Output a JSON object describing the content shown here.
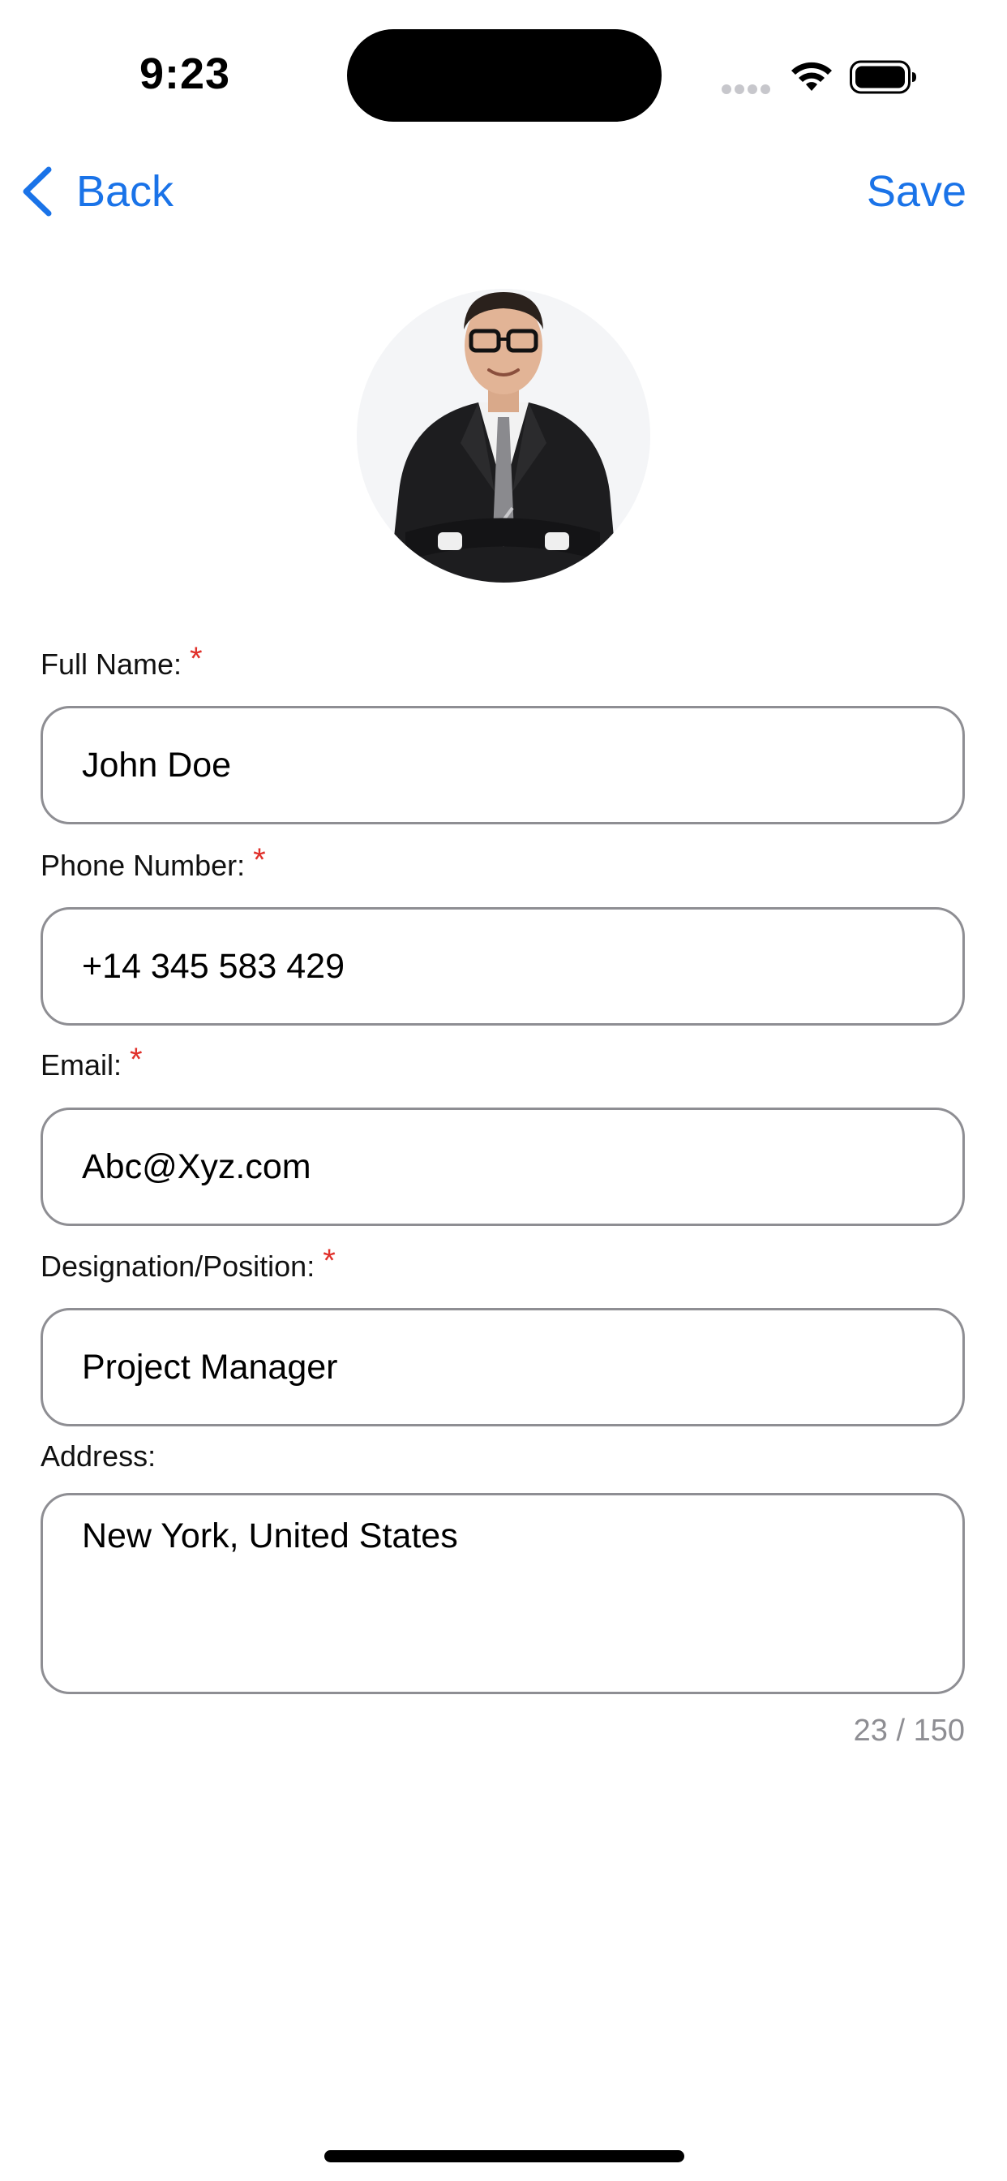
{
  "status_bar": {
    "time": "9:23"
  },
  "nav": {
    "back_label": "Back",
    "save_label": "Save",
    "accent_color": "#1a73e8"
  },
  "form": {
    "full_name": {
      "label": "Full Name:",
      "required_mark": "*",
      "value": "John Doe"
    },
    "phone": {
      "label": "Phone Number:",
      "required_mark": "*",
      "value": "+14 345 583 429"
    },
    "email": {
      "label": "Email:",
      "required_mark": "*",
      "value": "Abc@Xyz.com"
    },
    "designation": {
      "label": "Designation/Position:",
      "required_mark": "*",
      "value": "Project Manager"
    },
    "address": {
      "label": "Address:",
      "value": "New York, United States",
      "char_count": "23 / 150"
    }
  }
}
